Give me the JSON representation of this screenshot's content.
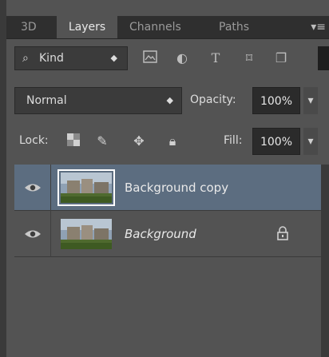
{
  "tabs": [
    {
      "label": "3D"
    },
    {
      "label": "Layers"
    },
    {
      "label": "Channels"
    },
    {
      "label": "Paths"
    }
  ],
  "tab_menu_icon": "panel-menu-icon",
  "filter": {
    "kind_label": "Kind",
    "icons": [
      "image-filter-icon",
      "adjustment-filter-icon",
      "type-filter-icon",
      "shape-filter-icon",
      "smart-object-filter-icon"
    ]
  },
  "blend": {
    "mode": "Normal",
    "opacity_label": "Opacity:",
    "opacity_value": "100%"
  },
  "lock": {
    "label": "Lock:",
    "icons": [
      "lock-transparent-icon",
      "lock-image-icon",
      "lock-position-icon",
      "lock-all-icon"
    ],
    "fill_label": "Fill:",
    "fill_value": "100%"
  },
  "layers": [
    {
      "name": "Background copy",
      "visible": true,
      "selected": true,
      "locked": false,
      "italic": false
    },
    {
      "name": "Background",
      "visible": true,
      "selected": false,
      "locked": true,
      "italic": true
    }
  ],
  "colors": {
    "panel": "#535353",
    "tabbar": "#2f2f2f",
    "selected_row": "#5c6d80"
  }
}
